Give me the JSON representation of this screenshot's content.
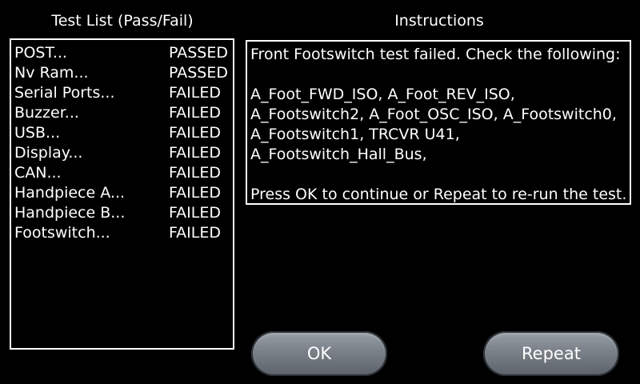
{
  "test_list": {
    "heading": "Test List (Pass/Fail)",
    "items": [
      {
        "name": "POST...",
        "status": "PASSED"
      },
      {
        "name": "Nv Ram...",
        "status": "PASSED"
      },
      {
        "name": "Serial Ports...",
        "status": "FAILED"
      },
      {
        "name": "Buzzer...",
        "status": "FAILED"
      },
      {
        "name": "USB...",
        "status": "FAILED"
      },
      {
        "name": "Display...",
        "status": "FAILED"
      },
      {
        "name": "CAN...",
        "status": "FAILED"
      },
      {
        "name": "Handpiece A...",
        "status": "FAILED"
      },
      {
        "name": "Handpiece B...",
        "status": "FAILED"
      },
      {
        "name": "Footswitch...",
        "status": "FAILED"
      }
    ]
  },
  "instructions": {
    "heading": "Instructions",
    "lines": [
      "Front Footswitch test failed. Check the following:",
      "",
      "A_Foot_FWD_ISO, A_Foot_REV_ISO,",
      "A_Footswitch2, A_Foot_OSC_ISO, A_Footswitch0,",
      "A_Footswitch1, TRCVR U41,",
      "A_Footswitch_Hall_Bus,",
      "",
      "Press OK to continue or Repeat to re-run the test."
    ]
  },
  "buttons": {
    "ok_label": "OK",
    "repeat_label": "Repeat"
  }
}
